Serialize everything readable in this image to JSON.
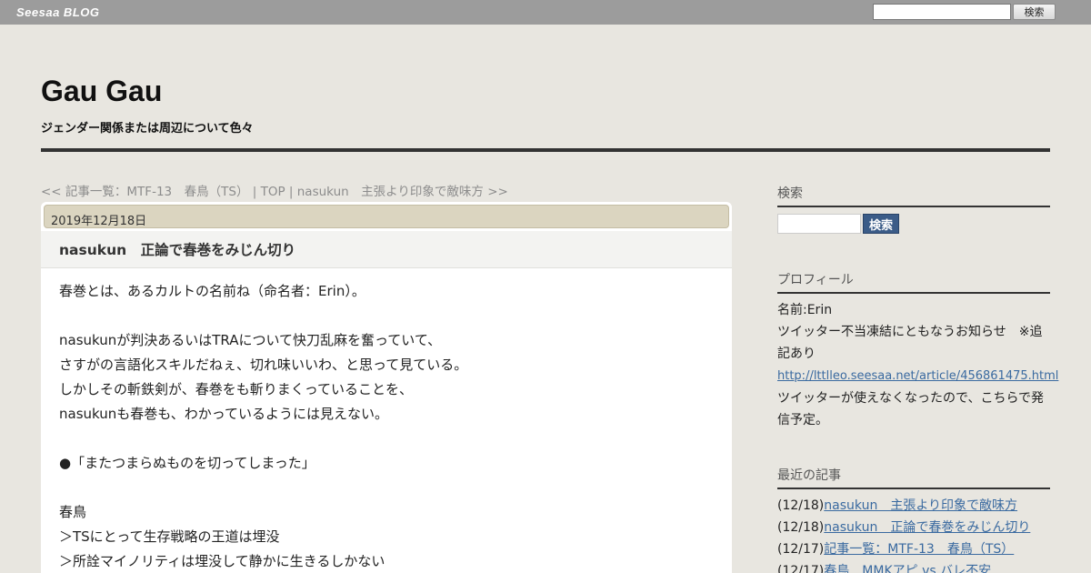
{
  "topbar": {
    "logo": "Seesaa BLOG",
    "search_placeholder": "",
    "search_button": "検索"
  },
  "header": {
    "title": "Gau Gau",
    "description": "ジェンダー関係または周辺について色々"
  },
  "nav": {
    "prev": "<< 記事一覧：MTF-13　春鳥（TS）",
    "sep1": " | ",
    "top": "TOP",
    "sep2": " | ",
    "next": "nasukun　主張より印象で敵味方 >>"
  },
  "article": {
    "date": "2019年12月18日",
    "title": "nasukun　正論で春巻をみじん切り",
    "lines": [
      "春巻とは、あるカルトの名前ね（命名者：Erin）。",
      "",
      "nasukunが判決あるいはTRAについて快刀乱麻を奮っていて、",
      "さすがの言語化スキルだねぇ、切れ味いいわ、と思って見ている。",
      "しかしその斬鉄剣が、春巻をも斬りまくっていることを、",
      "nasukunも春巻も、わかっているようには見えない。",
      "",
      "●「またつまらぬものを切ってしまった」",
      "",
      "春鳥",
      "＞TSにとって生存戦略の王道は埋没",
      "＞所詮マイノリティは埋没して静かに生きるしかない"
    ]
  },
  "sidebar": {
    "search_heading": "検索",
    "search_button": "検索",
    "profile_heading": "プロフィール",
    "profile_name": "名前:Erin",
    "profile_notice": "ツイッター不当凍結にともなうお知らせ　※追記あり",
    "profile_url": "http://lttlleo.seesaa.net/article/456861475.html",
    "profile_note": "ツイッターが使えなくなったので、こちらで発信予定。",
    "recent_heading": "最近の記事",
    "recent": [
      {
        "date": "(12/18)",
        "title": "nasukun　主張より印象で敵味方"
      },
      {
        "date": "(12/18)",
        "title": "nasukun　正論で春巻をみじん切り"
      },
      {
        "date": "(12/17)",
        "title": "記事一覧：MTF-13　春鳥（TS）"
      },
      {
        "date": "(12/17)",
        "title": "春鳥　MMKアピ vs バレ不安"
      }
    ]
  },
  "colors": {
    "topbar": "#9c9c9c",
    "background": "#e8e6e0",
    "date_bar": "#dbd5c0",
    "link": "#3a6aa0",
    "button": "#3b5c88"
  }
}
